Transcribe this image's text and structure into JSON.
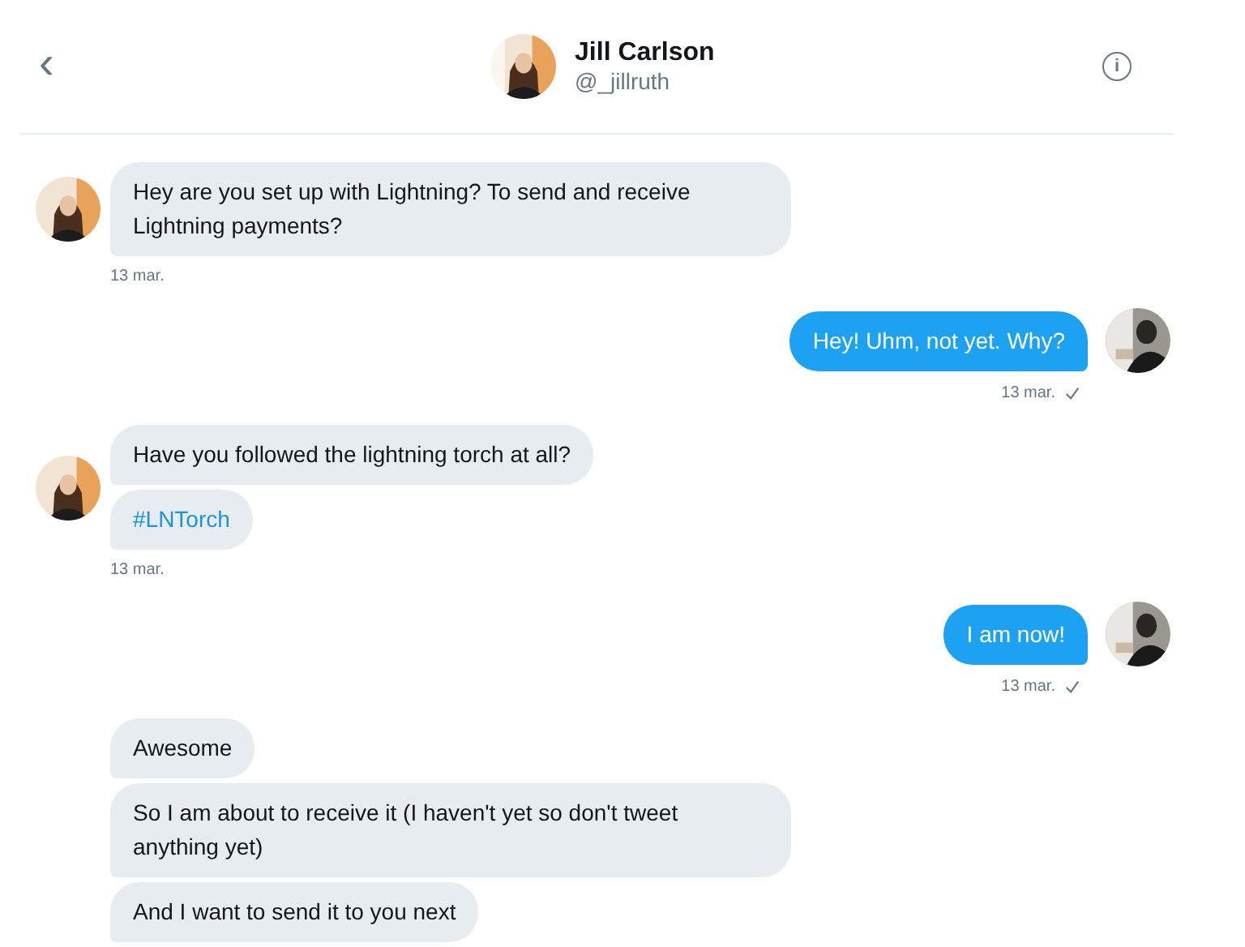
{
  "header": {
    "back": "‹",
    "name": "Jill Carlson",
    "handle": "@_jillruth",
    "info": "i"
  },
  "groups": [
    {
      "kind": "incoming",
      "avatar": true,
      "time": "13 mar.",
      "read": false,
      "messages": [
        {
          "kind": "text",
          "text": "Hey are you set up with Lightning? To send and receive Lightning payments?"
        }
      ]
    },
    {
      "kind": "outgoing",
      "avatar": true,
      "time": "13 mar.",
      "read": true,
      "messages": [
        {
          "kind": "text",
          "text": "Hey! Uhm, not yet. Why?"
        }
      ]
    },
    {
      "kind": "incoming",
      "avatar": true,
      "time": "13 mar.",
      "read": false,
      "messages": [
        {
          "kind": "text",
          "text": "Have you followed the lightning torch at all?"
        },
        {
          "kind": "hashtag",
          "text": "#LNTorch"
        }
      ]
    },
    {
      "kind": "outgoing",
      "avatar": true,
      "time": "13 mar.",
      "read": true,
      "messages": [
        {
          "kind": "text",
          "text": "I am now!"
        }
      ]
    },
    {
      "kind": "incoming",
      "avatar": false,
      "messages": [
        {
          "kind": "text",
          "text": "Awesome"
        },
        {
          "kind": "text",
          "text": "So I am about to receive it (I haven't yet so don't tweet anything yet)"
        },
        {
          "kind": "text",
          "text": "And I want to send it to you next"
        }
      ]
    }
  ]
}
